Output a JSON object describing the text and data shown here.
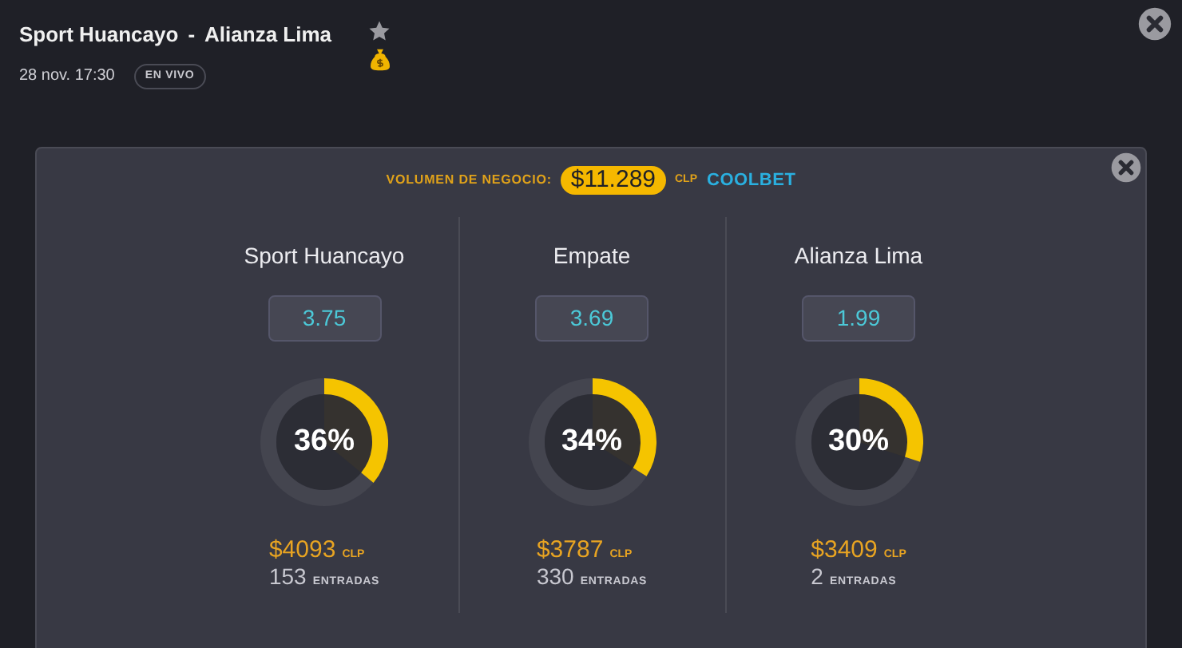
{
  "match": {
    "home": "Sport Huancayo",
    "separator": "-",
    "away": "Alianza Lima",
    "datetime": "28 nov. 17:30",
    "status": "EN VIVO"
  },
  "volume": {
    "label": "VOLUMEN DE NEGOCIO:",
    "amount": "$11.289",
    "currency": "CLP",
    "brand": "COOLBET"
  },
  "outcomes": [
    {
      "name": "Sport Huancayo",
      "odds": "3.75",
      "percent": "36%",
      "amount": "$4093",
      "currency": "CLP",
      "count": "153",
      "count_label": "ENTRADAS"
    },
    {
      "name": "Empate",
      "odds": "3.69",
      "percent": "34%",
      "amount": "$3787",
      "currency": "CLP",
      "count": "330",
      "count_label": "ENTRADAS"
    },
    {
      "name": "Alianza Lima",
      "odds": "1.99",
      "percent": "30%",
      "amount": "$3409",
      "currency": "CLP",
      "count": "2",
      "count_label": "ENTRADAS"
    }
  ]
}
